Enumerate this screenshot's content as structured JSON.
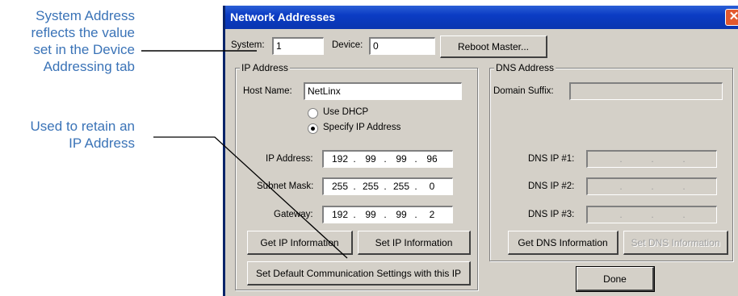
{
  "callouts": {
    "system_address": [
      "System Address",
      "reflects the value",
      "set in the Device",
      "Addressing tab"
    ],
    "retain_ip": [
      "Used to retain an",
      "IP Address"
    ]
  },
  "dialog": {
    "title": "Network Addresses",
    "close_glyph": "✕",
    "system_label": "System:",
    "system_value": "1",
    "device_label": "Device:",
    "device_value": "0",
    "reboot_button": "Reboot Master...",
    "ip_group": {
      "legend": "IP Address",
      "host_name_label": "Host Name:",
      "host_name_value": "NetLinx",
      "use_dhcp_label": "Use DHCP",
      "specify_ip_label": "Specify IP Address",
      "selected_mode": "Specify IP Address",
      "ip_address_label": "IP Address:",
      "ip_address": [
        "192",
        "99",
        "99",
        "96"
      ],
      "subnet_mask_label": "Subnet Mask:",
      "subnet_mask": [
        "255",
        "255",
        "255",
        "0"
      ],
      "gateway_label": "Gateway:",
      "gateway": [
        "192",
        "99",
        "99",
        "2"
      ],
      "get_ip_button": "Get IP Information",
      "set_ip_button": "Set IP Information",
      "set_default_button": "Set Default Communication Settings with this IP"
    },
    "dns_group": {
      "legend": "DNS Address",
      "domain_suffix_label": "Domain Suffix:",
      "domain_suffix_value": "",
      "dns1_label": "DNS IP #1:",
      "dns2_label": "DNS IP #2:",
      "dns3_label": "DNS IP #3:",
      "get_dns_button": "Get DNS Information",
      "set_dns_button": "Set DNS Information"
    },
    "done_button": "Done"
  },
  "colors": {
    "callout_text": "#3a73b7",
    "titlebar": "#0a35b0",
    "dialog_face": "#d4d0c8",
    "close_button": "#e2592f"
  }
}
